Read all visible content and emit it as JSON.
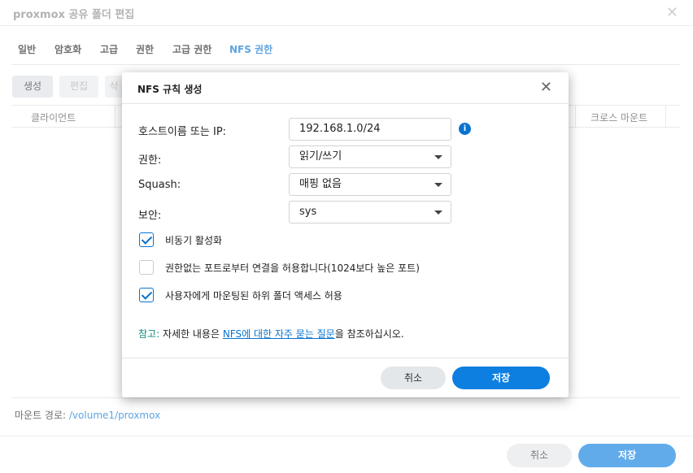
{
  "window": {
    "title": "proxmox 공유 폴더 편집",
    "close_glyph": "✕",
    "tabs": [
      {
        "label": "일반"
      },
      {
        "label": "암호화"
      },
      {
        "label": "고급"
      },
      {
        "label": "권한"
      },
      {
        "label": "고급 권한"
      },
      {
        "label": "NFS 권한"
      }
    ],
    "active_tab": "NFS 권한",
    "toolbar": {
      "create": "생성",
      "edit": "편집",
      "delete_partial": "삭"
    },
    "table_headers": {
      "client": "클라이언트",
      "cross_mount": "크로스 마운트"
    },
    "mount_path_label": "마운트 경로:",
    "mount_path_value": "/volume1/proxmox",
    "cancel_label": "취소",
    "save_label": "저장"
  },
  "dialog": {
    "title": "NFS 규칙 생성",
    "close_glyph": "✕",
    "fields": {
      "hostname": {
        "label": "호스트이름 또는 IP:",
        "value": "192.168.1.0/24"
      },
      "privilege": {
        "label": "권한:",
        "value": "읽기/쓰기"
      },
      "squash": {
        "label": "Squash:",
        "value": "매핑 없음"
      },
      "security": {
        "label": "보안:",
        "value": "sys"
      }
    },
    "info_glyph": "i",
    "checkboxes": [
      {
        "label": "비동기 활성화",
        "checked": true
      },
      {
        "label": "권한없는 포트로부터 연결을 허용합니다(1024보다 높은 포트)",
        "checked": false
      },
      {
        "label": "사용자에게 마운팅된 하위 폴더 액세스 허용",
        "checked": true
      }
    ],
    "note": {
      "prefix": "참고:",
      "text_before": " 자세한 내용은 ",
      "link": "NFS에 대한 자주 묻는 질문",
      "text_after": "을 참조하십시오."
    },
    "cancel_label": "취소",
    "save_label": "저장"
  },
  "colors": {
    "accent": "#0873cf",
    "primary_button": "#0d7fe0",
    "note_prefix": "#0d8c7a"
  }
}
